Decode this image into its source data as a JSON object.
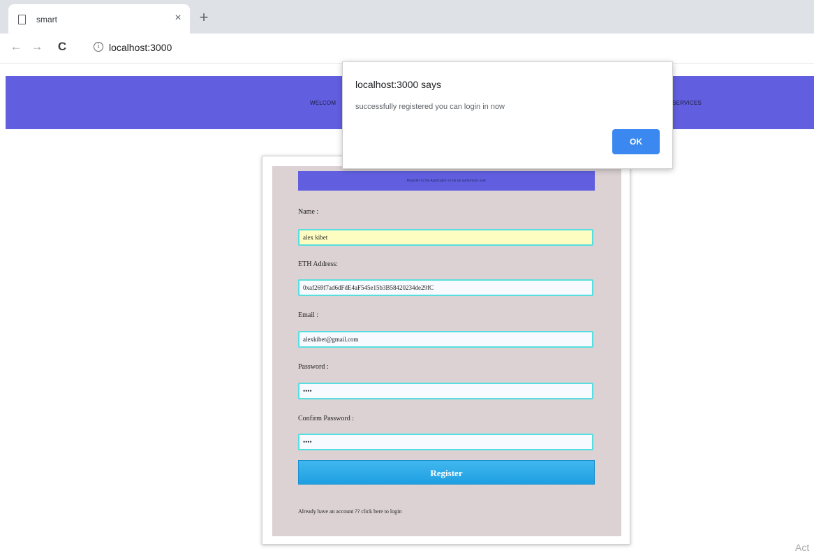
{
  "browser": {
    "tab_title": "smart",
    "tab_close": "×",
    "new_tab": "+",
    "back": "←",
    "forward": "→",
    "reload": "C",
    "info": "i",
    "url": "localhost:3000"
  },
  "header": {
    "nav_left": "WELCOM",
    "nav_right": "SERVICES"
  },
  "form": {
    "banner": "Register to the Application to be an authorized user",
    "name_label": "Name :",
    "name_value": "alex kibet",
    "eth_label": "ETH Address:",
    "eth_value": "0xaf269f7ad6dFdE4aF545e15b3B58420234de29fC",
    "email_label": "Email :",
    "email_value": "alexkibet@gmail.com",
    "password_label": "Password :",
    "password_value": "••••",
    "confirm_label": "Confirm Password :",
    "confirm_value": "••••",
    "register_button": "Register",
    "login_text": "Already have an account ?? click here to login"
  },
  "alert": {
    "title": "localhost:3000 says",
    "message": "successfully registered you can login in now",
    "ok_button": "OK"
  },
  "watermark": "Act",
  "colors": {
    "header": "#615fe0",
    "card_bg": "#dcd2d4",
    "input_border": "#58dede",
    "register_button": "#2aa8e8",
    "alert_ok": "#3a88f0"
  }
}
